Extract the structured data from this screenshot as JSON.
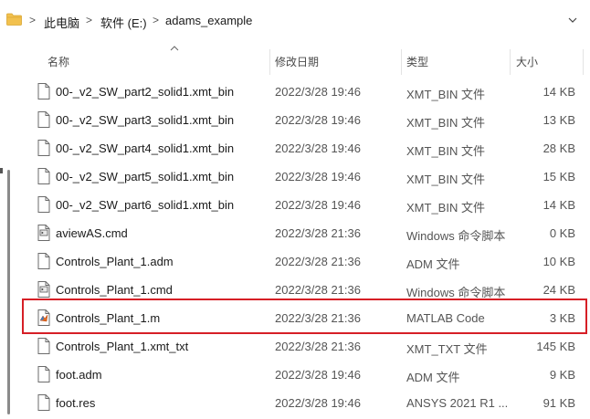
{
  "address_bar": {
    "crumbs": [
      "此电脑",
      "软件 (E:)",
      "adams_example"
    ],
    "separator": ">"
  },
  "columns": {
    "name": "名称",
    "date": "修改日期",
    "type": "类型",
    "size": "大小"
  },
  "files": [
    {
      "name": "00-_v2_SW_part2_solid1.xmt_bin",
      "date": "2022/3/28 19:46",
      "type": "XMT_BIN 文件",
      "size": "14 KB",
      "icon": "file-icon"
    },
    {
      "name": "00-_v2_SW_part3_solid1.xmt_bin",
      "date": "2022/3/28 19:46",
      "type": "XMT_BIN 文件",
      "size": "13 KB",
      "icon": "file-icon"
    },
    {
      "name": "00-_v2_SW_part4_solid1.xmt_bin",
      "date": "2022/3/28 19:46",
      "type": "XMT_BIN 文件",
      "size": "28 KB",
      "icon": "file-icon"
    },
    {
      "name": "00-_v2_SW_part5_solid1.xmt_bin",
      "date": "2022/3/28 19:46",
      "type": "XMT_BIN 文件",
      "size": "15 KB",
      "icon": "file-icon"
    },
    {
      "name": "00-_v2_SW_part6_solid1.xmt_bin",
      "date": "2022/3/28 19:46",
      "type": "XMT_BIN 文件",
      "size": "14 KB",
      "icon": "file-icon"
    },
    {
      "name": "aviewAS.cmd",
      "date": "2022/3/28 21:36",
      "type": "Windows 命令脚本",
      "size": "0 KB",
      "icon": "cmd-file-icon"
    },
    {
      "name": "Controls_Plant_1.adm",
      "date": "2022/3/28 21:36",
      "type": "ADM 文件",
      "size": "10 KB",
      "icon": "file-icon"
    },
    {
      "name": "Controls_Plant_1.cmd",
      "date": "2022/3/28 21:36",
      "type": "Windows 命令脚本",
      "size": "24 KB",
      "icon": "cmd-file-icon"
    },
    {
      "name": "Controls_Plant_1.m",
      "date": "2022/3/28 21:36",
      "type": "MATLAB Code",
      "size": "3 KB",
      "icon": "matlab-file-icon"
    },
    {
      "name": "Controls_Plant_1.xmt_txt",
      "date": "2022/3/28 21:36",
      "type": "XMT_TXT 文件",
      "size": "145 KB",
      "icon": "file-icon"
    },
    {
      "name": "foot.adm",
      "date": "2022/3/28 19:46",
      "type": "ADM 文件",
      "size": "9 KB",
      "icon": "file-icon"
    },
    {
      "name": "foot.res",
      "date": "2022/3/28 19:46",
      "type": "ANSYS 2021 R1 ...",
      "size": "91 KB",
      "icon": "file-icon"
    }
  ],
  "colors": {
    "highlight": "#d61f26",
    "folder": "#f2c14e"
  }
}
